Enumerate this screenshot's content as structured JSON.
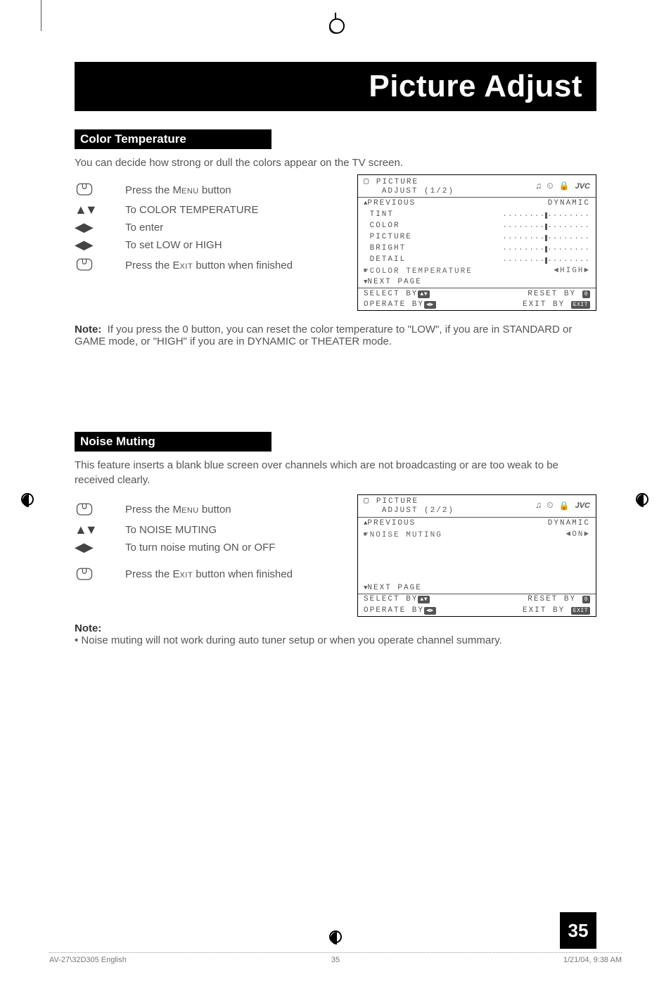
{
  "page_title": "Picture Adjust",
  "page_number": "35",
  "sections": {
    "color_temp": {
      "heading": "Color Temperature",
      "intro": "You can decide how strong or dull the colors appear on the TV screen.",
      "steps": [
        "Press the Menu button",
        "To COLOR TEMPERATURE",
        "To enter",
        "To set LOW or HIGH",
        "Press the Exit button when finished"
      ],
      "note_label": "Note:",
      "note_body": "If you press the 0 button, you can reset the color temperature to \"LOW\", if you are in STANDARD or GAME mode, or \"HIGH\" if you are in DYNAMIC or THEATER mode."
    },
    "noise_muting": {
      "heading": "Noise Muting",
      "intro": "This feature inserts a blank blue screen over channels which are not broadcasting or are too weak to be received clearly.",
      "steps": [
        "Press the Menu button",
        "To NOISE MUTING",
        "To turn noise muting ON or OFF",
        "Press the Exit button when finished"
      ],
      "note_label": "Note:",
      "note_bullet": "• Noise muting will not work during auto tuner setup or when you operate channel summary."
    }
  },
  "osd1": {
    "title1": "PICTURE",
    "title2": "ADJUST (1/2)",
    "mode": "DYNAMIC",
    "rows": {
      "previous": "PREVIOUS",
      "tint": "TINT",
      "color": "COLOR",
      "picture": "PICTURE",
      "bright": "BRIGHT",
      "detail": "DETAIL",
      "colortemp": "COLOR TEMPERATURE",
      "colortemp_val": "◄HIGH►",
      "next": "NEXT PAGE"
    },
    "footer": {
      "select": "SELECT   BY",
      "reset": "RESET BY",
      "operate": "OPERATE BY",
      "exit": "EXIT BY"
    },
    "badges": {
      "zero": "0",
      "exit": "EXIT"
    },
    "brand": "JVC"
  },
  "osd2": {
    "title1": "PICTURE",
    "title2": "ADJUST (2/2)",
    "mode": "DYNAMIC",
    "rows": {
      "previous": "PREVIOUS",
      "noise": "NOISE MUTING",
      "noise_val": "◄ON►",
      "next": "NEXT PAGE"
    },
    "footer": {
      "select": "SELECT   BY",
      "reset": "RESET BY",
      "operate": "OPERATE BY",
      "exit": "EXIT BY"
    },
    "badges": {
      "zero": "0",
      "exit": "EXIT"
    },
    "brand": "JVC"
  },
  "footer": {
    "left": "AV-27\\32D305 English",
    "mid": "35",
    "right": "1/21/04, 9:38 AM"
  },
  "glyphs": {
    "updown": "▲▼",
    "leftright": "◀ ▶",
    "tri_up": "▲",
    "tri_down": "▼",
    "note_music": "♫",
    "clock": "🕘",
    "lock": "🔒"
  }
}
